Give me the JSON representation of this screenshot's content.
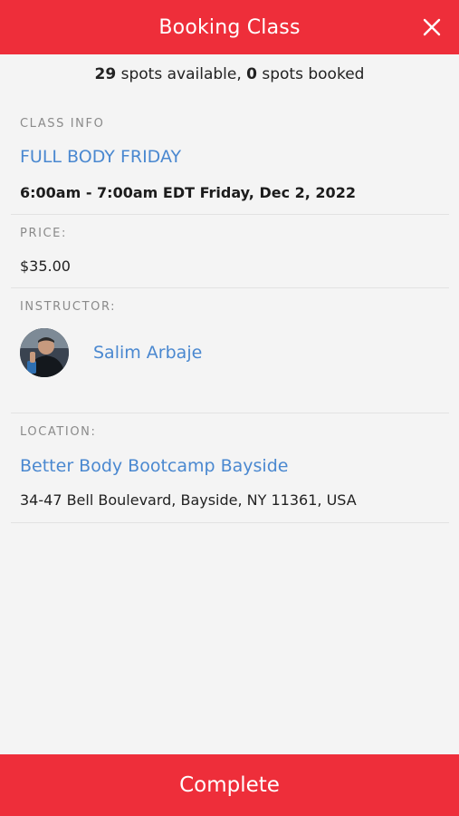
{
  "header": {
    "title": "Booking Class",
    "close_icon": "close-icon"
  },
  "availability": {
    "available_count": "29",
    "available_text": " spots available, ",
    "booked_count": "0",
    "booked_text": " spots booked"
  },
  "class_info": {
    "label": "CLASS INFO",
    "name": "FULL BODY FRIDAY",
    "schedule": "6:00am - 7:00am EDT Friday, Dec 2, 2022"
  },
  "price": {
    "label": "PRICE:",
    "value": "$35.00"
  },
  "instructor": {
    "label": "INSTRUCTOR:",
    "name": "Salim Arbaje"
  },
  "location": {
    "label": "LOCATION:",
    "name": "Better Body Bootcamp Bayside",
    "address": "34-47 Bell Boulevard, Bayside, NY 11361, USA"
  },
  "footer": {
    "complete_label": "Complete"
  },
  "colors": {
    "accent": "#ee2e3a",
    "link": "#4a88d0",
    "background": "#f4f4f4"
  }
}
